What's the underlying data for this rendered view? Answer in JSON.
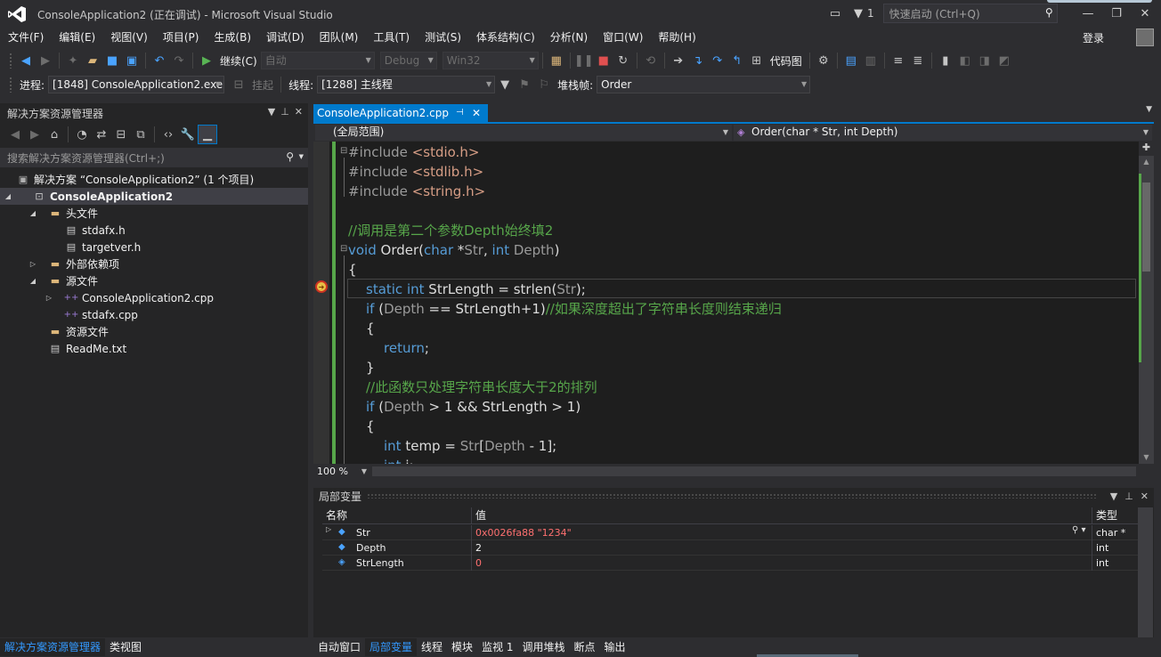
{
  "window": {
    "title": "ConsoleApplication2 (正在调试) - Microsoft Visual Studio",
    "filter_count": "1",
    "quick_launch_placeholder": "快速启动 (Ctrl+Q)",
    "login": "登录"
  },
  "menu": [
    "文件(F)",
    "编辑(E)",
    "视图(V)",
    "项目(P)",
    "生成(B)",
    "调试(D)",
    "团队(M)",
    "工具(T)",
    "测试(S)",
    "体系结构(C)",
    "分析(N)",
    "窗口(W)",
    "帮助(H)"
  ],
  "toolbar": {
    "continue_label": "继续(C)",
    "config_auto": "自动",
    "config_debug": "Debug",
    "config_platform": "Win32",
    "code_map": "代码图"
  },
  "debug_location": {
    "process_label": "进程:",
    "process_value": "[1848] ConsoleApplication2.exe",
    "suspend_label": "挂起",
    "thread_label": "线程:",
    "thread_value": "[1288] 主线程",
    "stack_label": "堆栈帧:",
    "stack_value": "Order"
  },
  "solution_explorer": {
    "title": "解决方案资源管理器",
    "search_placeholder": "搜索解决方案资源管理器(Ctrl+;)",
    "items": [
      {
        "label": "解决方案 “ConsoleApplication2” (1 个项目)"
      },
      {
        "label": "ConsoleApplication2"
      },
      {
        "label": "头文件"
      },
      {
        "label": "stdafx.h"
      },
      {
        "label": "targetver.h"
      },
      {
        "label": "外部依赖项"
      },
      {
        "label": "源文件"
      },
      {
        "label": "ConsoleApplication2.cpp"
      },
      {
        "label": "stdafx.cpp"
      },
      {
        "label": "资源文件"
      },
      {
        "label": "ReadMe.txt"
      }
    ]
  },
  "bottom_left_tabs": [
    "解决方案资源管理器",
    "类视图"
  ],
  "editor": {
    "tab_label": "ConsoleApplication2.cpp",
    "scope": "(全局范围)",
    "function": "Order(char * Str, int Depth)",
    "zoom": "100 %"
  },
  "code": {
    "l1": "#include ",
    "l1s": "<stdio.h>",
    "l2": "#include ",
    "l2s": "<stdlib.h>",
    "l3": "#include ",
    "l3s": "<string.h>",
    "l5": "//调用是第二个参数Depth始终填2",
    "l6a": "void",
    "l6b": " Order(",
    "l6c": "char",
    "l6d": " *",
    "l6e": "Str",
    "l6f": ", ",
    "l6g": "int",
    "l6h": " ",
    "l6i": "Depth",
    "l6j": ")",
    "l7": "{",
    "l8a": "static",
    "l8b": " ",
    "l8c": "int",
    "l8d": " StrLength = strlen(",
    "l8e": "Str",
    "l8f": ");",
    "l9a": "if",
    "l9b": " (",
    "l9c": "Depth",
    "l9d": " == StrLength+1)",
    "l9e": "//如果深度超出了字符串长度则结束递归",
    "l10": "{",
    "l11a": "return",
    "l11b": ";",
    "l12": "}",
    "l13": "//此函数只处理字符串长度大于2的排列",
    "l14a": "if",
    "l14b": " (",
    "l14c": "Depth",
    "l14d": " > 1 && StrLength > 1)",
    "l15": "{",
    "l16a": "int",
    "l16b": " temp = ",
    "l16c": "Str",
    "l16d": "[",
    "l16e": "Depth",
    "l16f": " - 1];",
    "l17a": "int",
    "l17b": " i;"
  },
  "locals": {
    "title": "局部变量",
    "columns": [
      "名称",
      "值",
      "类型"
    ],
    "rows": [
      {
        "name": "Str",
        "value": "0x0026fa88 \"1234\"",
        "type": "char *"
      },
      {
        "name": "Depth",
        "value": "2",
        "type": "int"
      },
      {
        "name": "StrLength",
        "value": "0",
        "type": "int"
      }
    ]
  },
  "bottom_tabs": [
    "自动窗口",
    "局部变量",
    "线程",
    "模块",
    "监视 1",
    "调用堆栈",
    "断点",
    "输出"
  ],
  "colors": {
    "accent": "#007acc",
    "keyword": "#569cd6",
    "comment": "#57a64a",
    "string": "#d69d85"
  }
}
